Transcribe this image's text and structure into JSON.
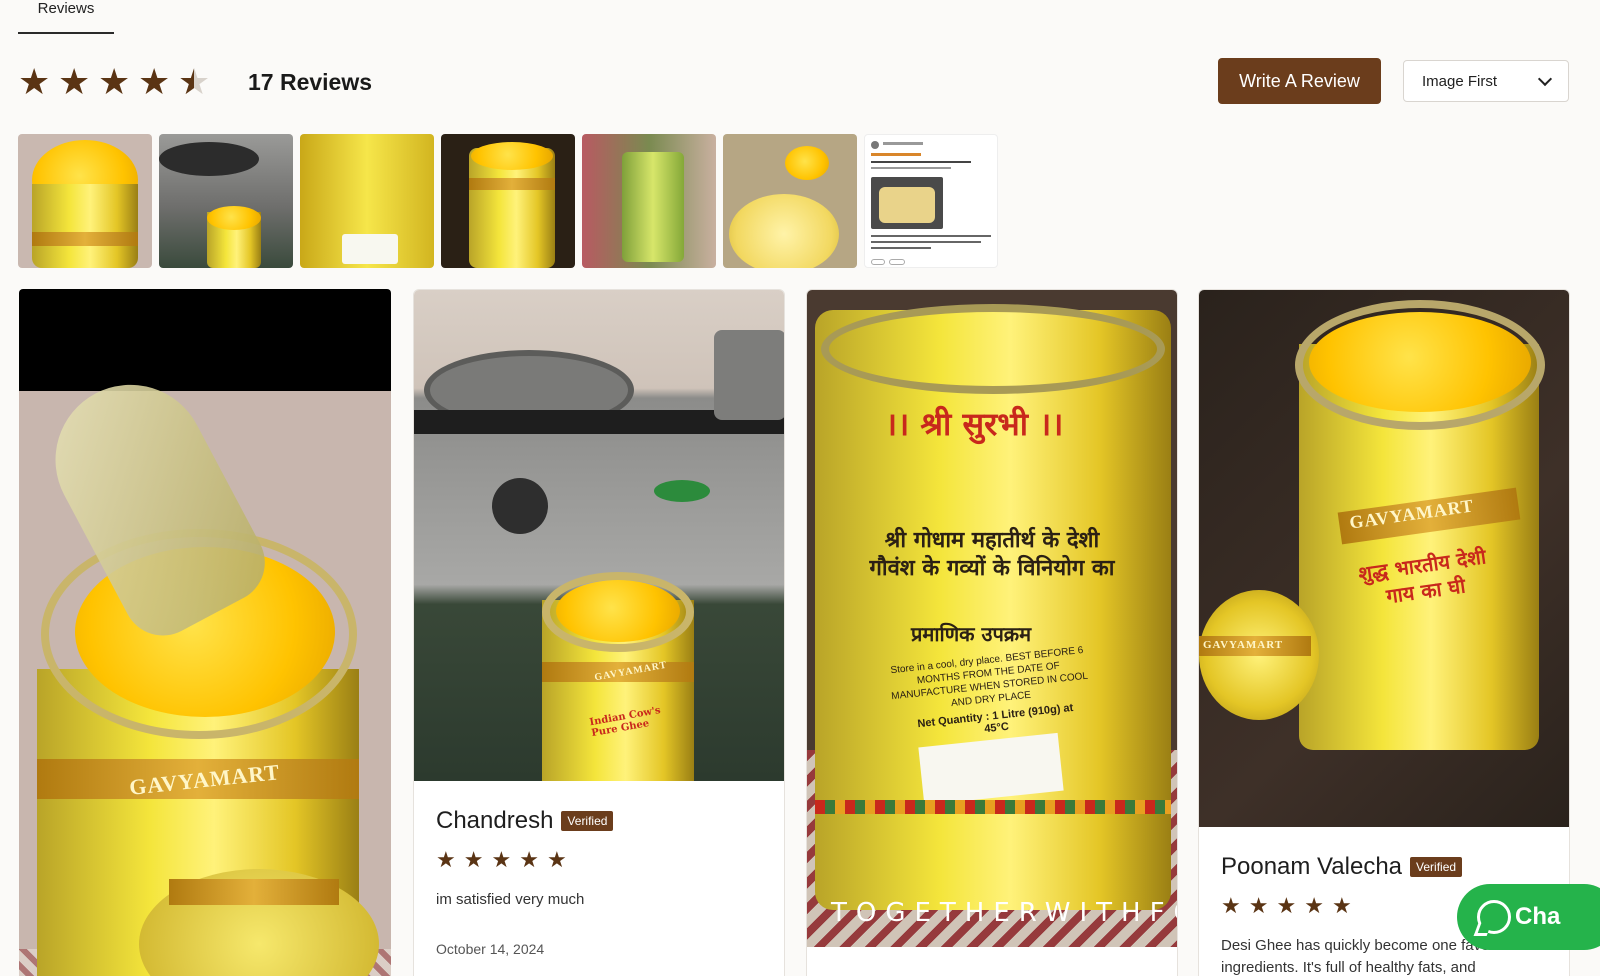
{
  "tabs": {
    "reviews_label": "Reviews"
  },
  "summary": {
    "rating": 4.5,
    "stars_max": 5,
    "review_count_label": "17 Reviews"
  },
  "actions": {
    "write_review_label": "Write A Review"
  },
  "sort": {
    "selected": "Image First"
  },
  "colors": {
    "accent": "#6b3d1c",
    "star": "#5a3414",
    "chat": "#25b34b"
  },
  "cards": [
    {
      "reviewer": "Chandresh",
      "badge": "Verified",
      "rating": 5,
      "text": "im satisfied very much",
      "date": "October 14, 2024"
    },
    {
      "reviewer": "Poonam Valecha",
      "badge": "Verified",
      "rating": 5,
      "text": "Desi Ghee has quickly become one favorite ingredients. It's full of healthy fats, and"
    }
  ],
  "photo_text": {
    "brand": "GAVYAMART",
    "hindi_1": "।। श्री सुरभी ।।",
    "hindi_2": "श्री गोधाम महातीर्थ के देशी गौवंश के गव्यों के विनियोग का",
    "hindi_3": "प्रमाणिक उपक्रम",
    "store_note": "Store in a cool, dry place. BEST BEFORE 6 MONTHS FROM THE DATE OF MANUFACTURE WHEN STORED IN COOL AND DRY PLACE",
    "net_qty": "Net Quantity : 1 Litre (910g) at 45°C",
    "watermark": "TOGETHERWITHFOOD",
    "label_en": "Indian Cow's Pure Ghee",
    "label_hi": "शुद्ध भारतीय देशी गाय का घी"
  },
  "chat": {
    "label": "Cha"
  }
}
